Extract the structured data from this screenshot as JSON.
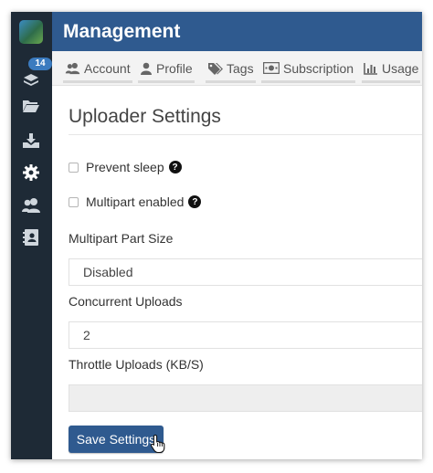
{
  "header": {
    "title": "Management"
  },
  "sidebar": {
    "badge": "14",
    "items": [
      {
        "icon": "uploads-icon"
      },
      {
        "icon": "folder-icon"
      },
      {
        "icon": "download-icon"
      },
      {
        "icon": "gear-icon",
        "active": true
      },
      {
        "icon": "users-icon"
      },
      {
        "icon": "contacts-icon"
      }
    ]
  },
  "tabs": [
    {
      "label": "Account",
      "icon": "users-icon"
    },
    {
      "label": "Profile",
      "icon": "user-icon"
    },
    {
      "label": "Tags",
      "icon": "tags-icon"
    },
    {
      "label": "Subscription",
      "icon": "money-icon"
    },
    {
      "label": "Usage",
      "icon": "bar-chart-icon"
    }
  ],
  "page": {
    "title": "Uploader Settings",
    "prevent_sleep": {
      "label": "Prevent sleep",
      "checked": false
    },
    "multipart_enabled": {
      "label": "Multipart enabled",
      "checked": false
    },
    "multipart_part_size": {
      "label": "Multipart Part Size",
      "value": "Disabled"
    },
    "concurrent_uploads": {
      "label": "Concurrent Uploads",
      "value": "2"
    },
    "throttle_uploads": {
      "label": "Throttle Uploads (KB/S)",
      "value": ""
    },
    "save_button": "Save Settings"
  },
  "colors": {
    "header": "#2f5a8f",
    "sidebar": "#1e2a36",
    "button": "#2f5a8f",
    "badge": "#3b7bbf"
  }
}
